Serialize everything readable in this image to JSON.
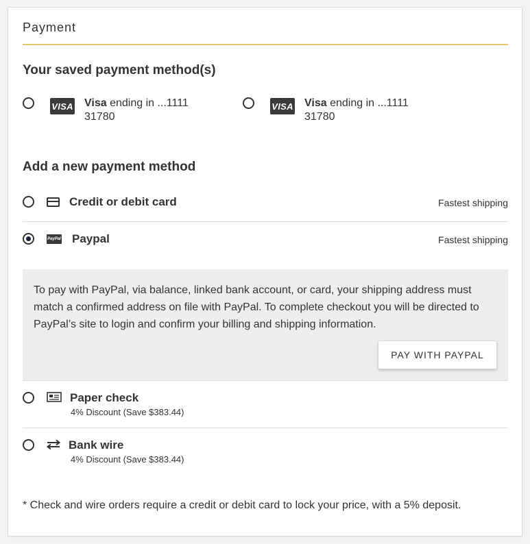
{
  "section_title": "Payment",
  "saved": {
    "heading": "Your saved payment method(s)",
    "methods": [
      {
        "brand": "Visa",
        "text": " ending in ...1111",
        "sub": "31780",
        "icon": "visa-icon"
      },
      {
        "brand": "Visa",
        "text": " ending in ...1111",
        "sub": "31780",
        "icon": "visa-icon"
      }
    ],
    "visa_badge": "VISA"
  },
  "add": {
    "heading": "Add a new payment method",
    "options": [
      {
        "label": "Credit or debit card",
        "note": "Fastest shipping",
        "icon": "credit-card-icon",
        "selected": false
      },
      {
        "label": "Paypal",
        "note": "Fastest shipping",
        "icon": "paypal-icon",
        "selected": true
      },
      {
        "label": "Paper check",
        "discount": "4% Discount (Save $383.44)",
        "icon": "check-icon",
        "selected": false
      },
      {
        "label": "Bank wire",
        "discount": "4% Discount (Save $383.44)",
        "icon": "transfer-arrows-icon",
        "selected": false
      }
    ],
    "paypal_badge": "PayPal",
    "paypal_info": "To pay with PayPal, via balance, linked bank account, or card, your shipping address must match a confirmed address on file with PayPal. To complete checkout you will be directed to PayPal’s site to login and confirm your billing and shipping information.",
    "paypal_button": "PAY WITH PAYPAL"
  },
  "footnote": "* Check and wire orders require a credit or debit card to lock your price, with a 5% deposit.",
  "colors": {
    "accent_rule": "#e7c56d",
    "selected_radio": "#1a1f3a",
    "info_bg": "#eeeeee"
  }
}
